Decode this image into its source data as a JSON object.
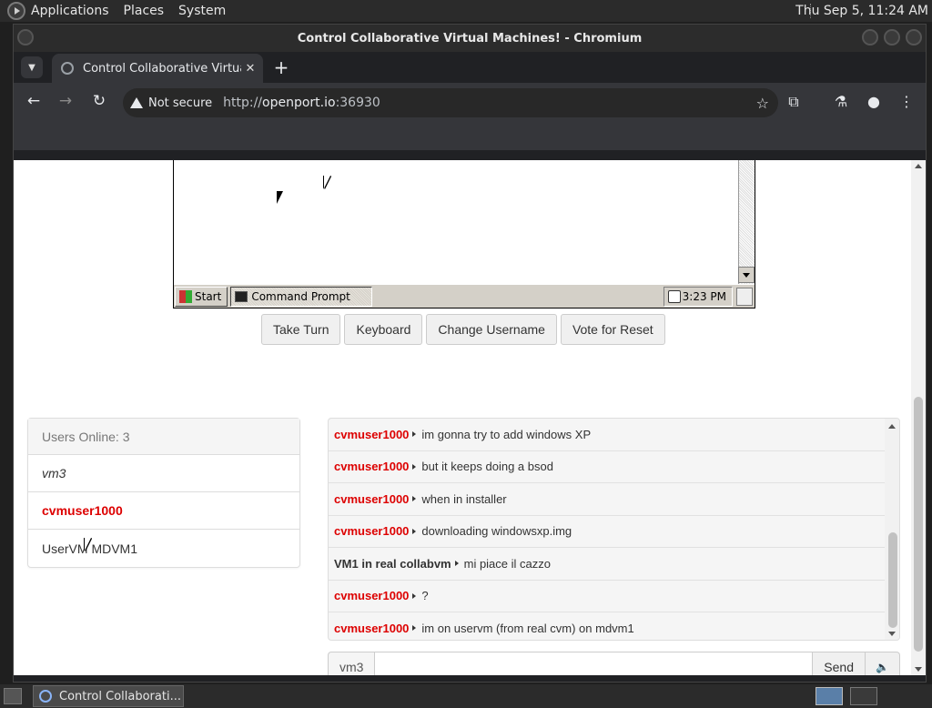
{
  "top_panel": {
    "menus": [
      "Applications",
      "Places",
      "System"
    ],
    "clock": "Thu Sep  5, 11:24 AM"
  },
  "window": {
    "title": "Control Collaborative Virtual Machines! - Chromium"
  },
  "browser": {
    "tab_title": "Control Collaborative Virtual",
    "tab_close": "✕",
    "new_tab": "+",
    "not_secure": "Not secure",
    "url_prefix": "http://",
    "url_host": "openport.io",
    "url_rest": ":36930"
  },
  "vm": {
    "start_label": "Start",
    "task_label": "Command Prompt",
    "clock": "3:23 PM"
  },
  "buttons": {
    "take_turn": "Take Turn",
    "keyboard": "Keyboard",
    "change_username": "Change Username",
    "vote_reset": "Vote for Reset"
  },
  "users": {
    "header": "Users Online: 3",
    "list": [
      "vm3",
      "cvmuser1000",
      "UserVM MDVM1"
    ]
  },
  "chat": {
    "messages": [
      {
        "user": "cvmuser1000",
        "text": "im gonna try to add windows XP"
      },
      {
        "user": "cvmuser1000",
        "text": "but it keeps doing a bsod"
      },
      {
        "user": "cvmuser1000",
        "text": "when in installer"
      },
      {
        "user": "cvmuser1000",
        "text": "downloading windowsxp.img"
      },
      {
        "user": "VM1 in real collabvm",
        "text": "mi piace il cazzo"
      },
      {
        "user": "cvmuser1000",
        "text": "?"
      },
      {
        "user": "cvmuser1000",
        "text": "im on uservm (from real cvm) on mdvm1"
      }
    ],
    "username_addon": "vm3",
    "input_value": "",
    "send_label": "Send",
    "volume_icon": "🔈"
  },
  "taskbar": {
    "task_label": "Control Collaborati..."
  },
  "colors": {
    "admin_red": "#dd0000",
    "panel_bg": "#2b2b2b"
  }
}
